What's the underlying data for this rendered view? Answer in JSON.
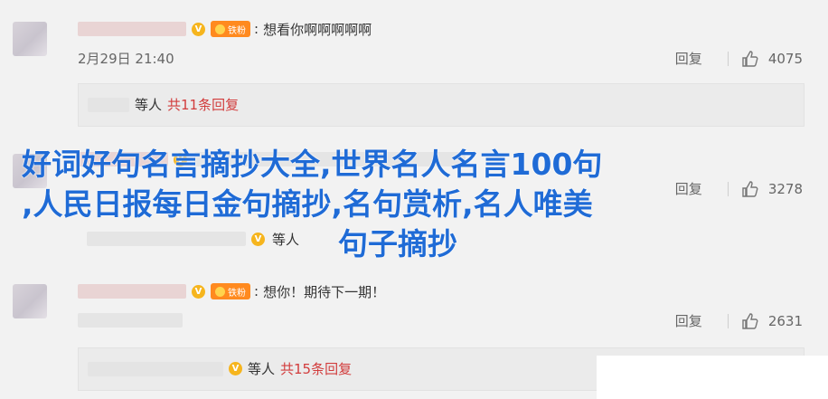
{
  "comments": [
    {
      "text": "想看你啊啊啊啊啊",
      "fan_badge": "铁粉",
      "time": "2月29日 21:40",
      "reply_label": "回复",
      "likes": "4075",
      "sub": {
        "mid": "等人",
        "count_text": "共11条回复"
      }
    },
    {
      "text": "",
      "time": "",
      "reply_label": "回复",
      "likes": "3278",
      "sub": {
        "mid": "等人",
        "count_text": ""
      }
    },
    {
      "text": "想你！期待下一期！",
      "fan_badge": "铁粉",
      "time": "",
      "reply_label": "回复",
      "likes": "2631",
      "sub": {
        "mid": "等人",
        "count_text": "共15条回复"
      }
    }
  ],
  "overlay": {
    "line1": "好词好句名言摘抄大全,世界名人名言100句",
    "line2": ",人民日报每日金句摘抄,名句赏析,名人唯美",
    "line3": "句子摘抄"
  },
  "colors": {
    "overlay_text": "#1f6bd6",
    "reply_count": "#d23c3c",
    "fan_badge": "#ff8a1f",
    "v_badge": "#f6b51e"
  },
  "icons": [
    "v-badge-icon",
    "thumbs-up-icon",
    "fan-medal-icon"
  ]
}
